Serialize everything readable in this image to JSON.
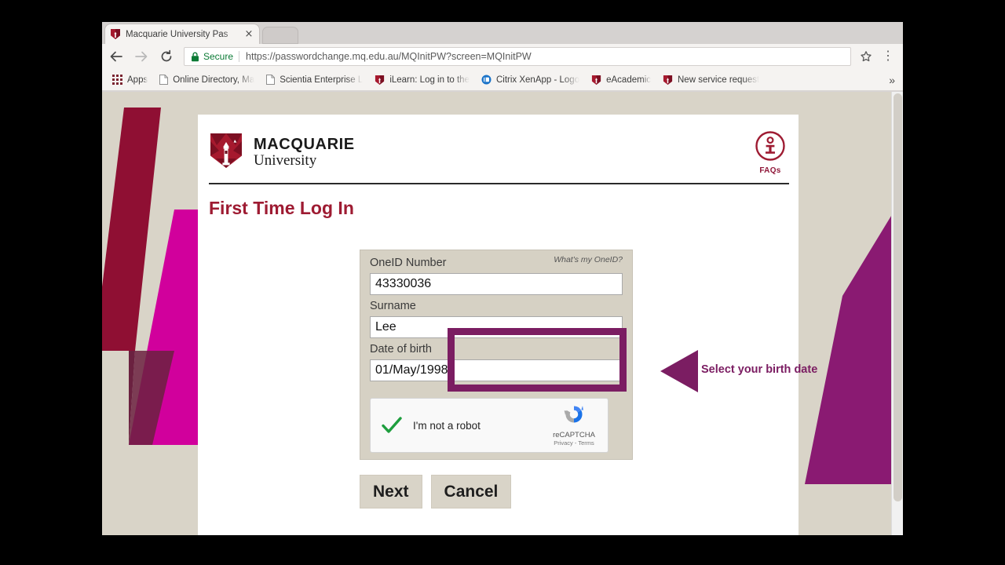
{
  "browser": {
    "tab": {
      "title": "Macquarie University Pas",
      "favicon": "mq-shield-icon",
      "close_label": "×"
    },
    "nav": {
      "back": "←",
      "forward": "→",
      "reload": "⟳"
    },
    "omnibox": {
      "secure_label": "Secure",
      "url_scheme": "https://",
      "url_host": "passwordchange.mq.edu.au",
      "url_path": "/MQInitPW?screen=MQInitPW",
      "url_full": "https://passwordchange.mq.edu.au/MQInitPW?screen=MQInitPW",
      "lock_icon": "lock-icon",
      "star_icon": "star-icon"
    },
    "menu_glyph": "⋮",
    "bookmarks": {
      "apps_label": "Apps",
      "items": [
        {
          "label": "Online Directory, Ma",
          "icon": "page-icon"
        },
        {
          "label": "Scientia Enterprise L",
          "icon": "page-icon"
        },
        {
          "label": "iLearn: Log in to the",
          "icon": "mq-shield-icon"
        },
        {
          "label": "Citrix XenApp - Logo",
          "icon": "citrix-icon"
        },
        {
          "label": "eAcademic",
          "icon": "mq-shield-icon"
        },
        {
          "label": "New service request",
          "icon": "mq-shield-icon"
        }
      ],
      "overflow_glyph": "»"
    }
  },
  "page": {
    "brand": {
      "line1": "MACQUARIE",
      "line2": "University",
      "logo_icon": "mq-shield-icon"
    },
    "faqs": {
      "label": "FAQs",
      "icon": "info-circle-icon"
    },
    "title": "First Time Log In",
    "form": {
      "oneid": {
        "label": "OneID Number",
        "hint": "What's my OneID?",
        "value": "43330036",
        "placeholder": ""
      },
      "surname": {
        "label": "Surname",
        "value": "Lee",
        "placeholder": ""
      },
      "dob": {
        "label": "Date of birth",
        "value": "01/May/1998",
        "placeholder": ""
      },
      "recaptcha": {
        "checkbox_state": "checked",
        "check_glyph": "✓",
        "label": "I'm not a robot",
        "brand": "reCAPTCHA",
        "terms": "Privacy - Terms"
      }
    },
    "buttons": {
      "next": "Next",
      "cancel": "Cancel"
    }
  },
  "annotation": {
    "text": "Select your birth date",
    "highlight_target": "date-of-birth-field",
    "arrow_direction": "left"
  },
  "colors": {
    "brand_crimson": "#9e1b32",
    "annotation_purple": "#7b1d62",
    "deco_magenta": "#cc0099",
    "deco_dark_red": "#8f0f33",
    "deco_purple": "#8a1a72",
    "page_beige": "#d9d4c8",
    "panel_beige": "#d6d1c4",
    "secure_green": "#0b7a35"
  }
}
